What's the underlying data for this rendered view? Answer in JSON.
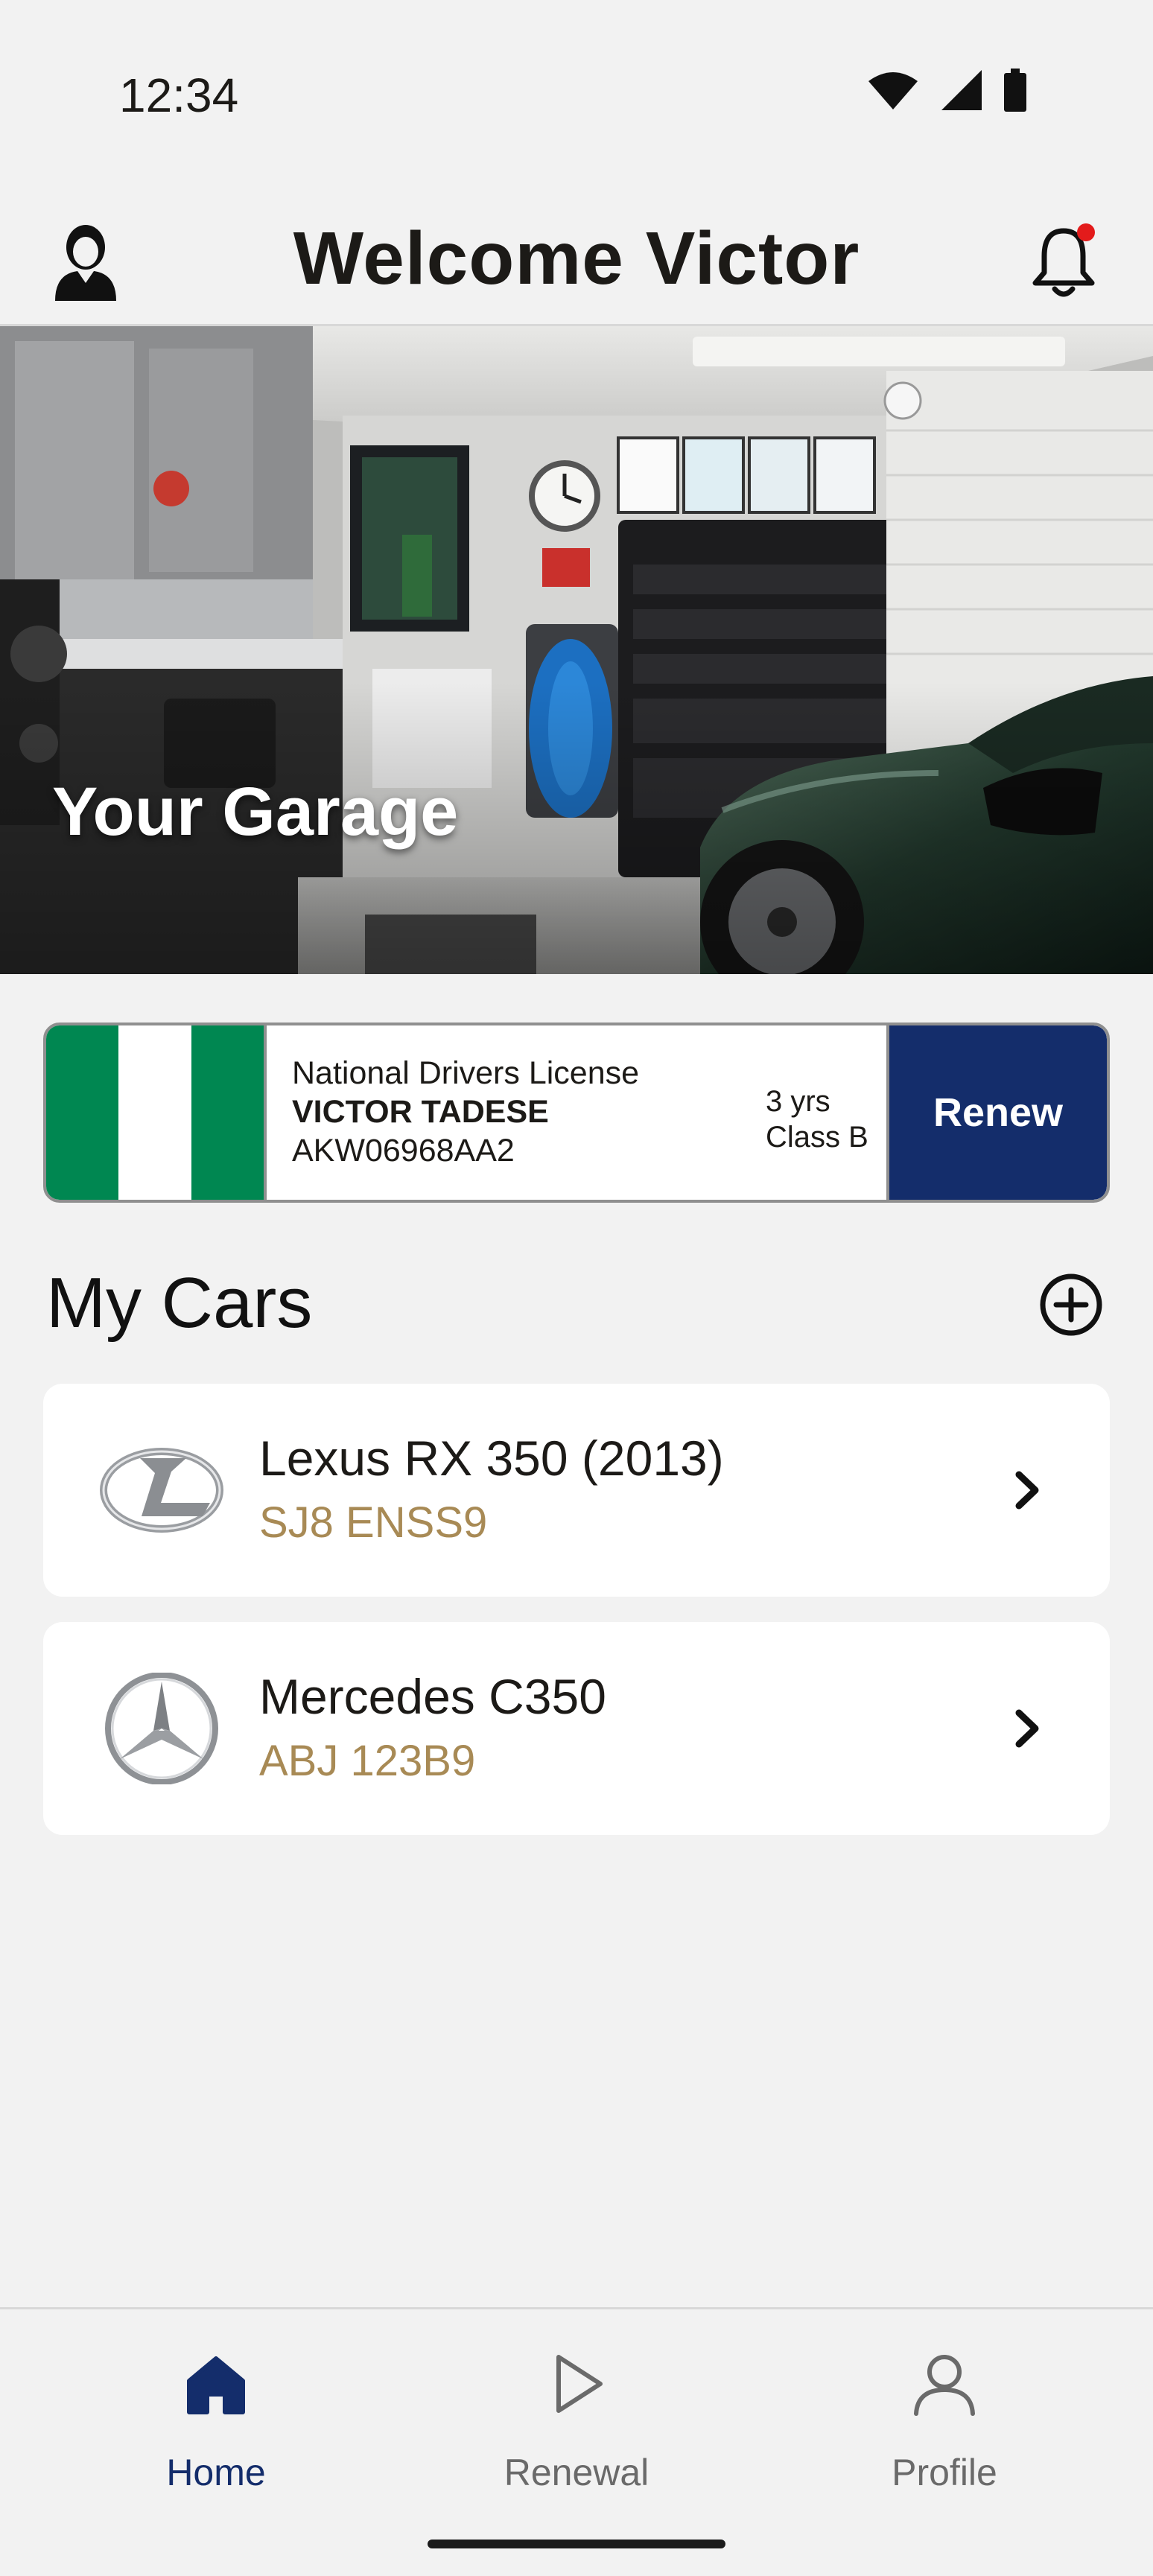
{
  "status_bar": {
    "time": "12:34"
  },
  "header": {
    "title": "Welcome Victor"
  },
  "hero": {
    "label": "Your Garage"
  },
  "license": {
    "type": "National Drivers License",
    "holder": "VICTOR TADESE",
    "number": "AKW06968AA2",
    "validity": "3 yrs",
    "class": "Class B",
    "renew_label": "Renew",
    "flag_colors": [
      "#008751",
      "#ffffff",
      "#008751"
    ]
  },
  "cars_section": {
    "title": "My Cars"
  },
  "cars": [
    {
      "name": "Lexus RX 350 (2013)",
      "plate": "SJ8 ENSS9",
      "logo": "lexus-logo"
    },
    {
      "name": "Mercedes C350",
      "plate": "ABJ 123B9",
      "logo": "mercedes-logo"
    }
  ],
  "nav": {
    "items": [
      {
        "label": "Home",
        "icon": "home-icon",
        "active": true
      },
      {
        "label": "Renewal",
        "icon": "play-icon",
        "active": false
      },
      {
        "label": "Profile",
        "icon": "person-icon",
        "active": false
      }
    ]
  },
  "colors": {
    "accent": "#142d6b",
    "plate_text": "#a88a55",
    "notification_dot": "#e31b1b"
  }
}
